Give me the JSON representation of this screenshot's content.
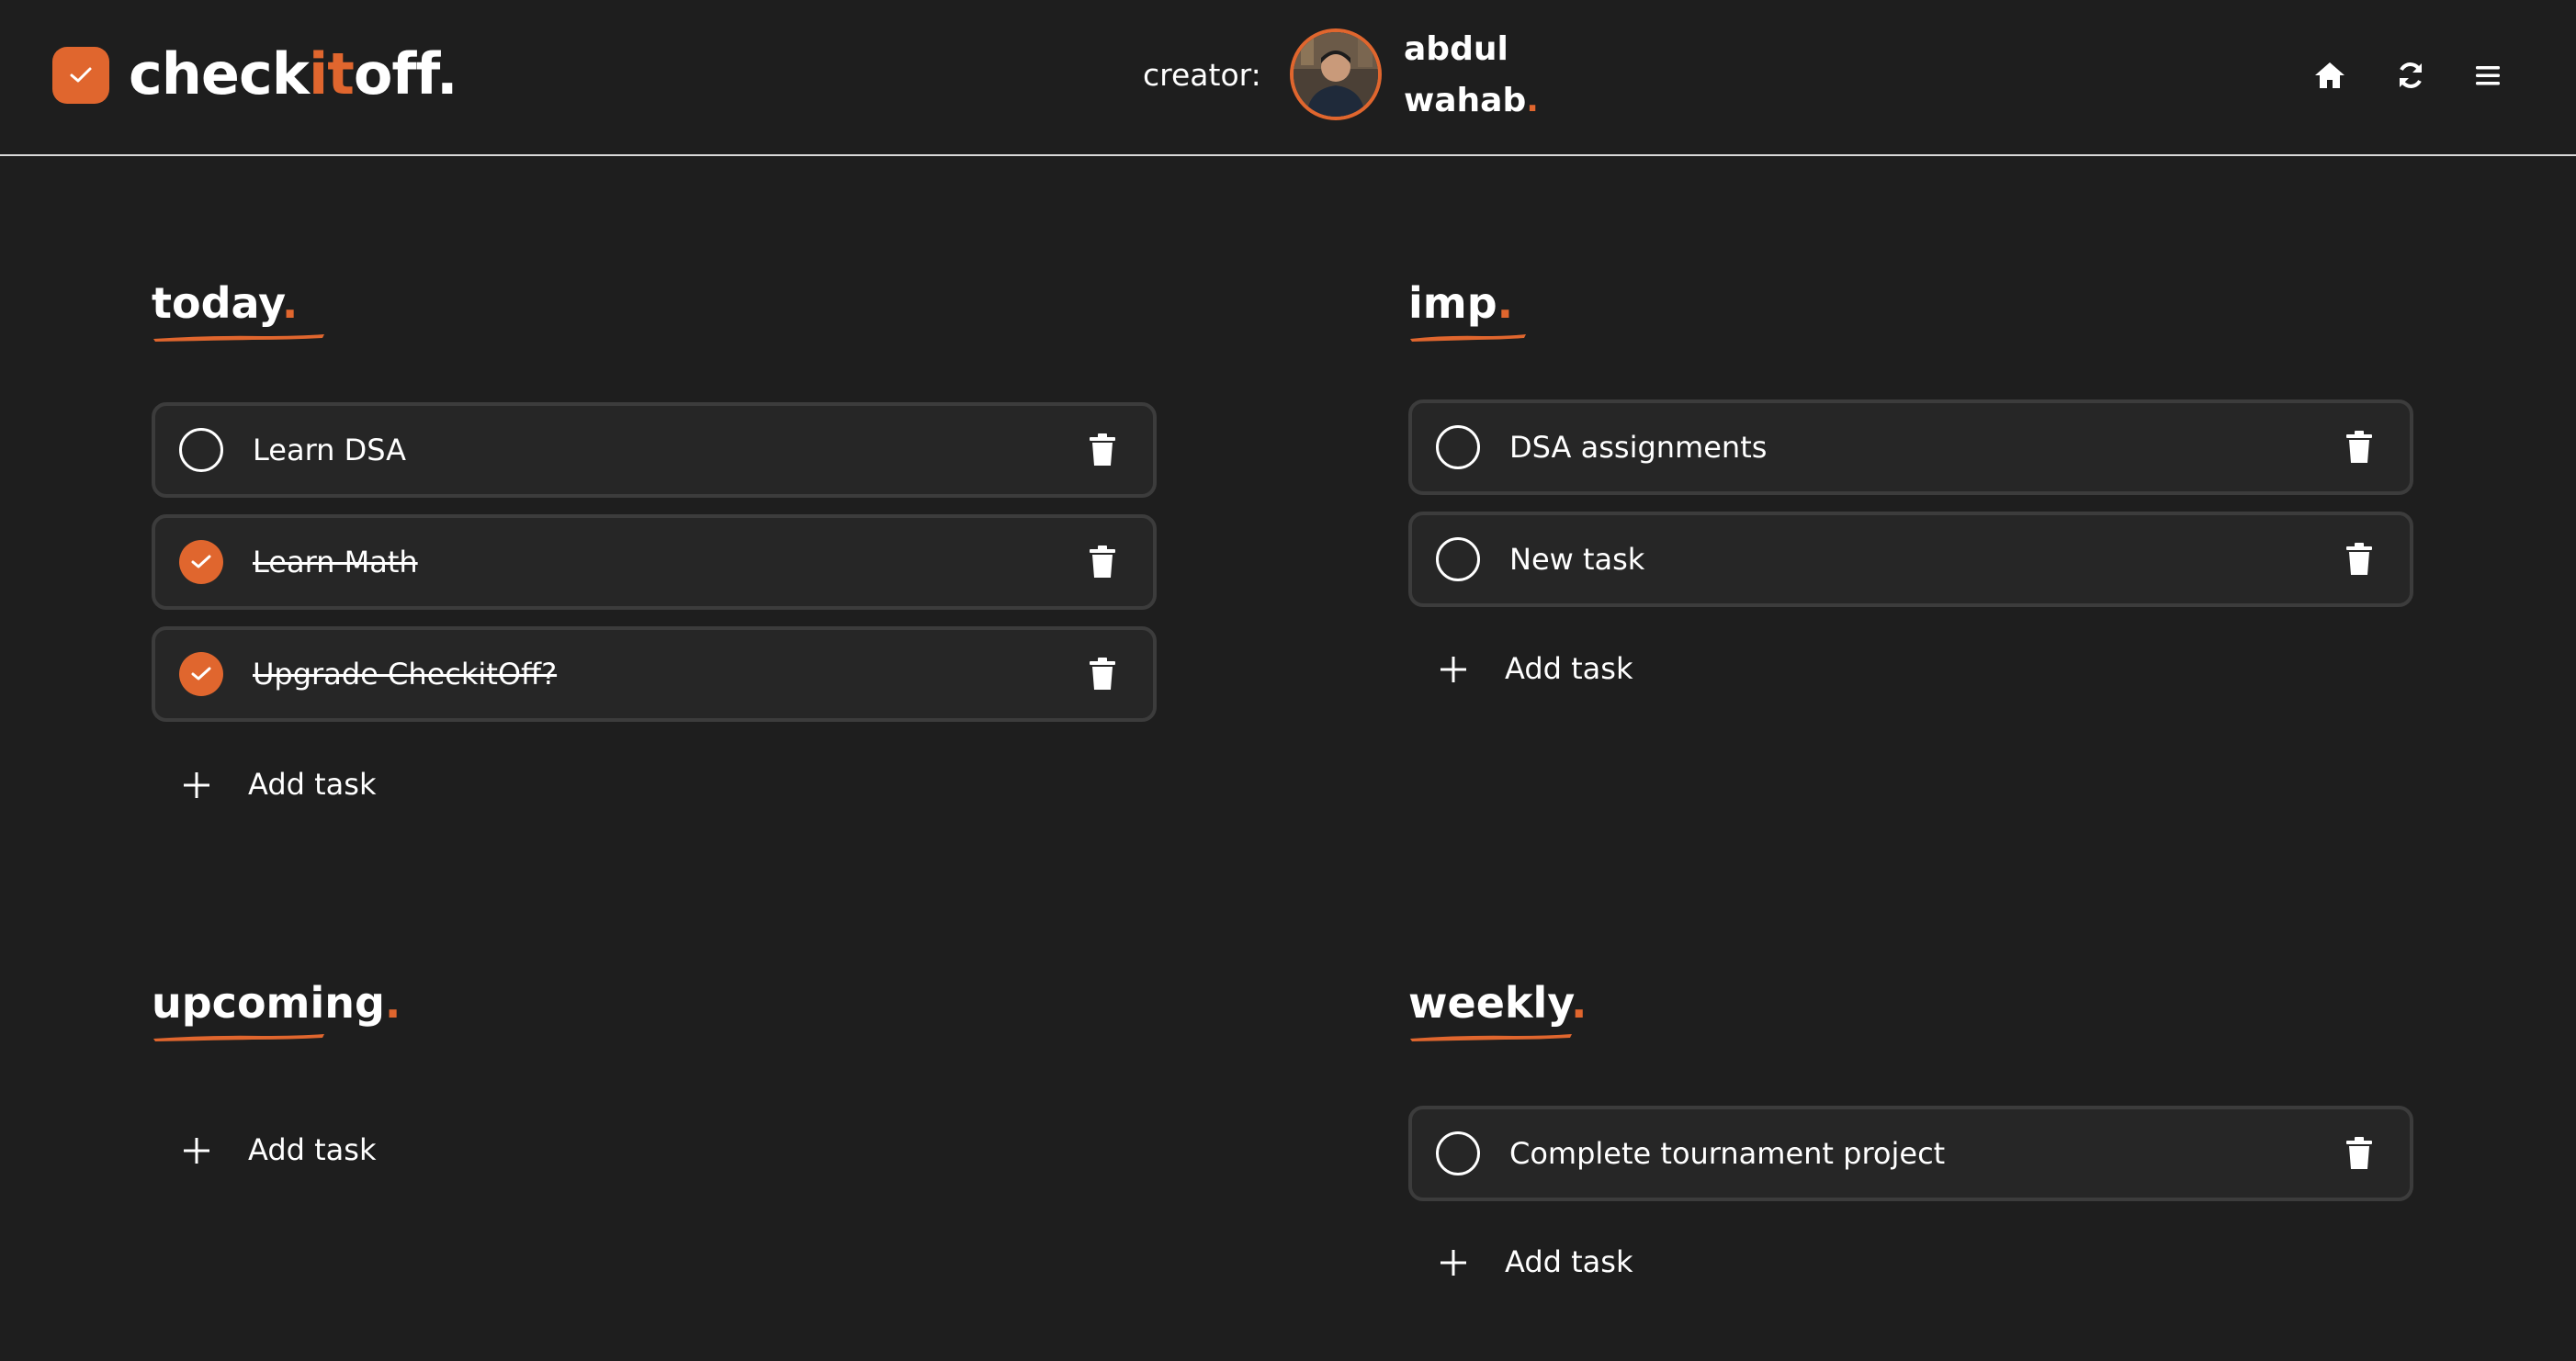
{
  "colors": {
    "accent": "#e0662e",
    "background": "#1e1e1e",
    "card": "#262626",
    "card_border": "#3c3c3c"
  },
  "header": {
    "brand": {
      "part1": "check",
      "part2": "it",
      "part3": "off."
    },
    "creator_label": "creator:",
    "creator_first": "abdul",
    "creator_last": "wahab",
    "creator_dot": ".",
    "icons": [
      "home-icon",
      "refresh-icon",
      "menu-icon"
    ]
  },
  "sections": {
    "today": {
      "title": "today",
      "dot": ".",
      "tasks": [
        {
          "text": "Learn DSA",
          "done": false
        },
        {
          "text": "Learn Math",
          "done": true
        },
        {
          "text": "Upgrade CheckitOff?",
          "done": true
        }
      ],
      "add_label": "Add task"
    },
    "imp": {
      "title": "imp",
      "dot": ".",
      "tasks": [
        {
          "text": "DSA assignments",
          "done": false
        },
        {
          "text": "New task",
          "done": false
        }
      ],
      "add_label": "Add task"
    },
    "upcoming": {
      "title": "upcoming",
      "dot": ".",
      "tasks": [],
      "add_label": "Add task"
    },
    "weekly": {
      "title": "weekly",
      "dot": ".",
      "tasks": [
        {
          "text": "Complete tournament project",
          "done": false
        }
      ],
      "add_label": "Add task"
    }
  }
}
